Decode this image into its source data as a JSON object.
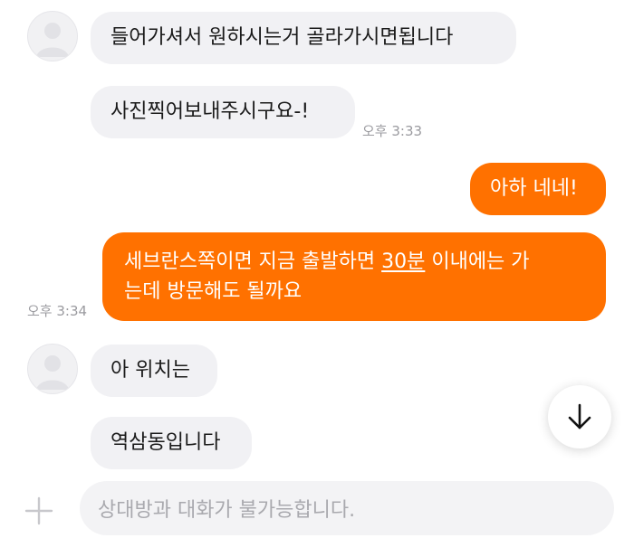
{
  "messages": {
    "m1": {
      "text": "들어가셔서 원하시는거 골라가시면됩니다"
    },
    "m2": {
      "text": "사진찍어보내주시구요-!",
      "time": "오후 3:33"
    },
    "m3": {
      "text": "아하 네네!"
    },
    "m4": {
      "line1_pre": "세브란스쪽이면 지금 출발하면 ",
      "line1_link": "30분",
      "line1_post": " 이내에는 가",
      "line2": "는데 방문해도 될까요",
      "time": "오후 3:34"
    },
    "m5": {
      "text": "아 위치는"
    },
    "m6": {
      "text": "역삼동입니다"
    }
  },
  "composer": {
    "placeholder": "상대방과 대화가 불가능합니다."
  },
  "icons": {
    "avatar": "default-profile-icon",
    "scroll": "arrow-down-icon",
    "attach": "plus-icon"
  },
  "colors": {
    "outgoing_bubble": "#ff7100",
    "incoming_bubble": "#f1f1f4",
    "timestamp": "#9a9a9f"
  }
}
